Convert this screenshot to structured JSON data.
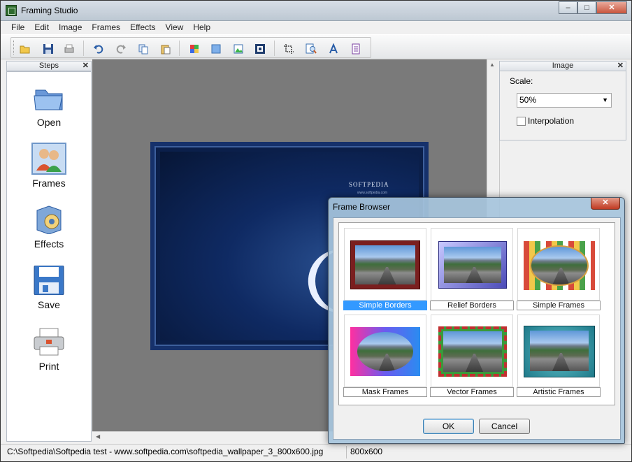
{
  "window": {
    "title": "Framing Studio"
  },
  "menubar": [
    "File",
    "Edit",
    "Image",
    "Frames",
    "Effects",
    "View",
    "Help"
  ],
  "steps_panel": {
    "title": "Steps",
    "items": [
      {
        "label": "Open",
        "icon": "folder-icon"
      },
      {
        "label": "Frames",
        "icon": "frames-people-icon",
        "active": true
      },
      {
        "label": "Effects",
        "icon": "effects-box-icon"
      },
      {
        "label": "Save",
        "icon": "floppy-disk-icon"
      },
      {
        "label": "Print",
        "icon": "printer-icon"
      }
    ]
  },
  "image_panel": {
    "title": "Image",
    "scale_label": "Scale:",
    "scale_value": "50%",
    "interpolation_label": "Interpolation",
    "interpolation_checked": false
  },
  "canvas": {
    "watermark": "SOFTPEDIA",
    "watermark_sub": "www.softpedia.com"
  },
  "frame_browser": {
    "title": "Frame Browser",
    "tiles": [
      {
        "label": "Simple Borders",
        "selected": true
      },
      {
        "label": "Relief Borders"
      },
      {
        "label": "Simple Frames"
      },
      {
        "label": "Mask Frames"
      },
      {
        "label": "Vector Frames"
      },
      {
        "label": "Artistic Frames"
      }
    ],
    "ok_label": "OK",
    "cancel_label": "Cancel"
  },
  "statusbar": {
    "path": "C:\\Softpedia\\Softpedia test - www.softpedia.com\\softpedia_wallpaper_3_800x600.jpg",
    "dimensions": "800x600"
  },
  "colors": {
    "selection": "#3399ff",
    "canvas": "#7a7a7a"
  }
}
